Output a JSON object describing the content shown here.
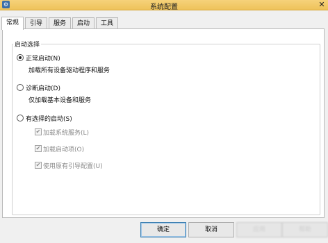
{
  "window": {
    "title": "系统配置",
    "icon": "settings-app-icon",
    "close": "✕"
  },
  "tabs": [
    {
      "label": "常规"
    },
    {
      "label": "引导"
    },
    {
      "label": "服务"
    },
    {
      "label": "启动"
    },
    {
      "label": "工具"
    }
  ],
  "startup_group": {
    "legend": "启动选择",
    "normal": {
      "label": "正常启动(N)",
      "desc": "加载所有设备驱动程序和服务",
      "selected": true
    },
    "diagnostic": {
      "label": "诊断启动(D)",
      "desc": "仅加载基本设备和服务",
      "selected": false
    },
    "selective": {
      "label": "有选择的启动(S)",
      "selected": false,
      "options": [
        {
          "label": "加载系统服务(L)",
          "checked": true
        },
        {
          "label": "加载启动项(O)",
          "checked": true
        },
        {
          "label": "使用原有引导配置(U)",
          "checked": true
        }
      ]
    }
  },
  "buttons": {
    "ok": "确定",
    "cancel": "取消",
    "apply": "应用",
    "help": "帮助"
  }
}
